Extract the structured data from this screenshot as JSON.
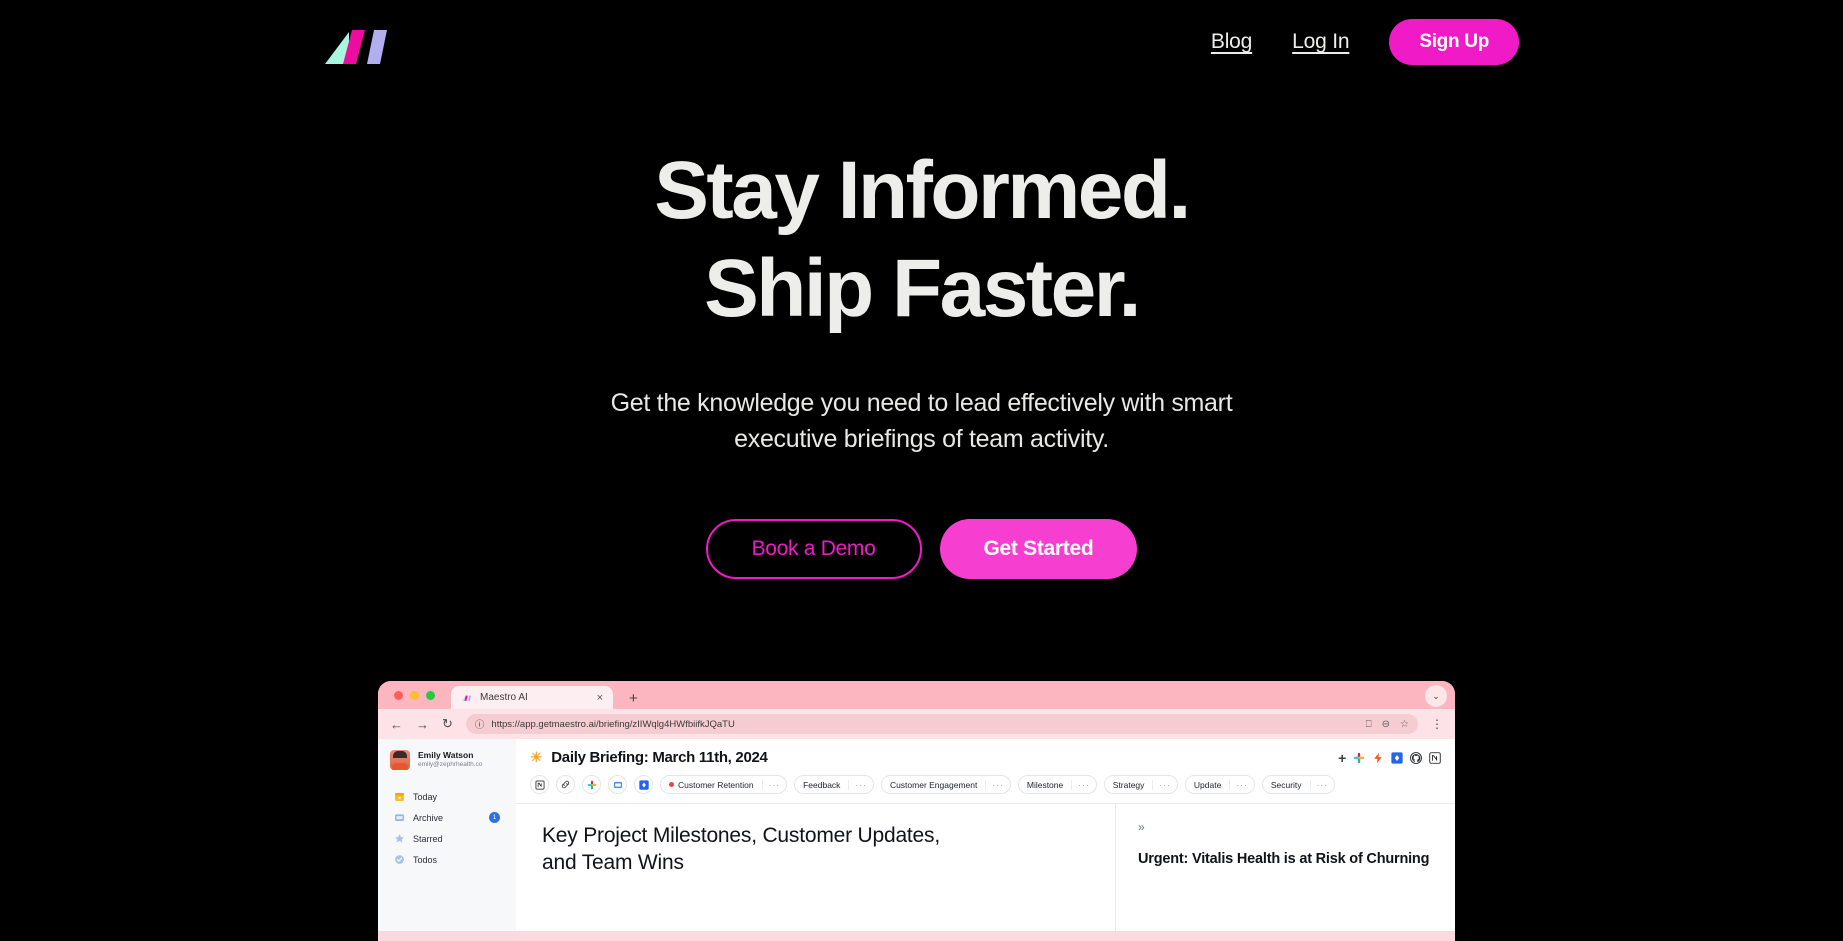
{
  "nav": {
    "logo_name": "maestro-logo",
    "links": [
      {
        "label": "Blog"
      },
      {
        "label": "Log In"
      }
    ],
    "signup_label": "Sign Up"
  },
  "hero": {
    "headline_line1": "Stay Informed.",
    "headline_line2": "Ship Faster.",
    "sub_line1": "Get the knowledge you need to lead effectively with smart",
    "sub_line2": "executive briefings of team activity.",
    "cta_secondary": "Book a Demo",
    "cta_primary": "Get Started"
  },
  "browser": {
    "tab_title": "Maestro AI",
    "tab_close": "×",
    "new_tab": "+",
    "tab_list_chevron": "⌄",
    "back": "←",
    "forward": "→",
    "reload": "↻",
    "site_info": "ⓘ",
    "url": "https://app.getmaestro.ai/briefing/zIIWqlg4HWfbiifkJQaTU",
    "cast": "⎕",
    "zoom_out": "⊖",
    "bookmark": "☆",
    "menu": "⋮"
  },
  "app": {
    "user": {
      "name": "Emily Watson",
      "email": "emily@zephrhealth.co"
    },
    "sidebar": [
      {
        "label": "Today",
        "icon": "calendar-icon",
        "badge": ""
      },
      {
        "label": "Archive",
        "icon": "archive-icon",
        "badge": "1"
      },
      {
        "label": "Starred",
        "icon": "star-icon",
        "badge": ""
      },
      {
        "label": "Todos",
        "icon": "check-circle-icon",
        "badge": ""
      }
    ],
    "briefing_title": "Daily Briefing: March 11th, 2024",
    "briefing_emoji": "☀",
    "add_label": "+",
    "integrations": [
      "slack-icon",
      "zapier-icon",
      "jira-icon",
      "github-icon",
      "notion-icon"
    ],
    "tools": [
      "notion-tool-icon",
      "link-tool-icon",
      "slack-tool-icon",
      "front-tool-icon",
      "jira-tool-icon"
    ],
    "tags": [
      {
        "label": "Customer Retention",
        "dot": true,
        "more": "···"
      },
      {
        "label": "Feedback",
        "dot": false,
        "more": "···"
      },
      {
        "label": "Customer Engagement",
        "dot": false,
        "more": "···"
      },
      {
        "label": "Milestone",
        "dot": false,
        "more": "···"
      },
      {
        "label": "Strategy",
        "dot": false,
        "more": "···"
      },
      {
        "label": "Update",
        "dot": false,
        "more": "···"
      },
      {
        "label": "Security",
        "dot": false,
        "more": "···"
      }
    ],
    "main_heading": "Key Project Milestones, Customer Updates, and Team Wins",
    "panel_expand": "»",
    "panel_heading": "Urgent: Vitalis Health is at Risk of Churning"
  },
  "colors": {
    "background": "#000000",
    "text": "#ededeb",
    "accent_magenta": "#f01ac6",
    "accent_pink": "#f63fd0",
    "logo_mint": "#a8f5e0",
    "logo_magenta": "#ec0c9e",
    "logo_periwinkle": "#b3aef0",
    "badge_blue": "#2f6fe4",
    "tag_dot_red": "#ef4444"
  }
}
